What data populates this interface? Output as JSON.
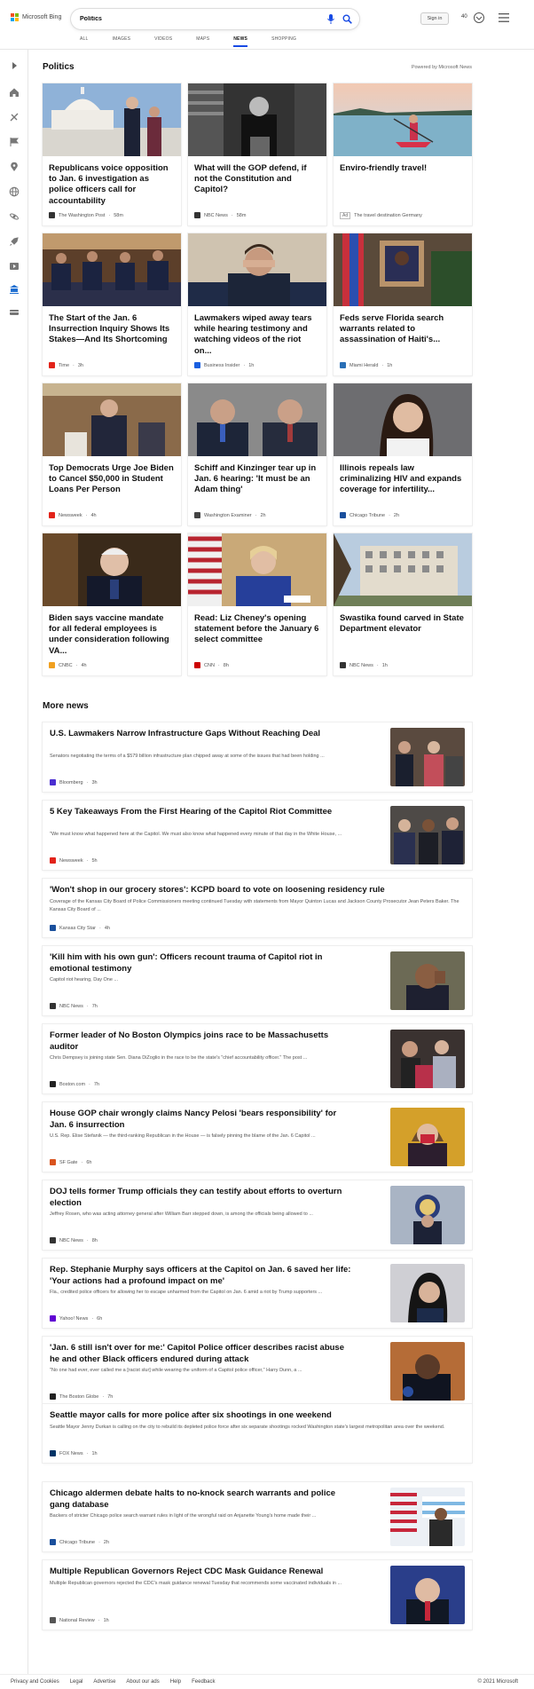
{
  "header": {
    "brand": "Microsoft Bing",
    "search_value": "Politics",
    "signin_label": "Sign in",
    "points": "40",
    "tabs": [
      {
        "label": "ALL"
      },
      {
        "label": "IMAGES"
      },
      {
        "label": "VIDEOS"
      },
      {
        "label": "MAPS"
      },
      {
        "label": "NEWS"
      },
      {
        "label": "SHOPPING"
      }
    ],
    "active_tab": "NEWS"
  },
  "sidebar": {
    "icons": [
      "expand-icon",
      "home-icon",
      "sports-icon",
      "flag-icon",
      "location-icon",
      "globe-icon",
      "science-icon",
      "rocket-icon",
      "entertainment-icon",
      "bank-icon",
      "money-icon"
    ]
  },
  "section": {
    "title": "Politics",
    "powered_by": "Powered by Microsoft News"
  },
  "cards": [
    {
      "title": "Republicans voice opposition to Jan. 6 investigation as police officers call for accountability",
      "source": "The Washington Post",
      "time": "58m",
      "logo_color": "#333",
      "image": "capitol"
    },
    {
      "title": "What will the GOP defend, if not the Constitution and Capitol?",
      "source": "NBC News",
      "time": "58m",
      "logo_color": "#333",
      "image": "podium-bw"
    },
    {
      "title": "Enviro-friendly travel!",
      "source": "The travel destination Germany",
      "time": "",
      "ad": "Ad",
      "logo_color": "",
      "image": "kayak"
    },
    {
      "title": "The Start of the Jan. 6 Insurrection Inquiry Shows Its Stakes—And Its Shortcoming",
      "source": "Time",
      "time": "3h",
      "logo_color": "#e2231a",
      "image": "hearing"
    },
    {
      "title": "Lawmakers wiped away tears while hearing testimony and watching videos of the riot on...",
      "source": "Business Insider",
      "time": "1h",
      "logo_color": "#1a5fe0",
      "image": "tears"
    },
    {
      "title": "Feds serve Florida search warrants related to assassination of Haiti's...",
      "source": "Miami Herald",
      "time": "1h",
      "logo_color": "#2a6fb5",
      "image": "portrait"
    },
    {
      "title": "Top Democrats Urge Joe Biden to Cancel $50,000 in Student Loans Per Person",
      "source": "Newsweek",
      "time": "4h",
      "logo_color": "#e2231a",
      "image": "senate"
    },
    {
      "title": "Schiff and Kinzinger tear up in Jan. 6 hearing: 'It must be an Adam thing'",
      "source": "Washington Examiner",
      "time": "2h",
      "logo_color": "#444",
      "image": "schiff"
    },
    {
      "title": "Illinois repeals law criminalizing HIV and expands coverage for infertility...",
      "source": "Chicago Tribune",
      "time": "2h",
      "logo_color": "#1a4f9c",
      "image": "woman"
    },
    {
      "title": "Biden says vaccine mandate for all federal employees is under consideration following VA...",
      "source": "CNBC",
      "time": "4h",
      "logo_color": "#f0a020",
      "image": "biden"
    },
    {
      "title": "Read: Liz Cheney's opening statement before the January 6 select committee",
      "source": "CNN",
      "time": "8h",
      "logo_color": "#cc0000",
      "image": "cheney"
    },
    {
      "title": "Swastika found carved in State Department elevator",
      "source": "NBC News",
      "time": "1h",
      "logo_color": "#333",
      "image": "building"
    }
  ],
  "more_news": {
    "title": "More news",
    "items": [
      {
        "title": "U.S. Lawmakers Narrow Infrastructure Gaps Without Reaching Deal",
        "snippet": "Senators negotiating the terms of a $579 billion infrastructure plan chipped away at some of the issues that had been holding ...",
        "source": "Bloomberg",
        "time": "3h",
        "logo_color": "#4a2ed1",
        "image": "infra"
      },
      {
        "title": "5 Key Takeaways From the First Hearing of the Capitol Riot Committee",
        "snippet": "\"We must know what happened here at the Capitol. We must also know what happened every minute of that day in the White House, ...",
        "source": "Newsweek",
        "time": "5h",
        "logo_color": "#e2231a",
        "image": "police"
      },
      {
        "title": "'Won't shop in our grocery stores': KCPD board to vote on loosening residency rule",
        "snippet": "Coverage of the Kansas City Board of Police Commissioners meeting continued Tuesday with statements from Mayor Quinton Lucas and Jackson County Prosecutor Jean Peters Baker. The Kansas City Board of ...",
        "source": "Kansas City Star",
        "time": "4h",
        "logo_color": "#1a4f9c",
        "image": ""
      },
      {
        "title": "'Kill him with his own gun': Officers recount trauma of Capitol riot in emotional testimony",
        "snippet": "Capitol riot hearing, Day One ...",
        "source": "NBC News",
        "time": "7h",
        "logo_color": "#333",
        "image": "officer"
      },
      {
        "title": "Former leader of No Boston Olympics joins race to be Massachusetts auditor",
        "snippet": "Chris Dempsey is joining state Sen. Diana DiZoglio in the race to be the state's \"chief accountability officer.\" The post ...",
        "source": "Boston.com",
        "time": "7h",
        "logo_color": "#222",
        "image": "boston"
      },
      {
        "title": "House GOP chair wrongly claims Nancy Pelosi 'bears responsibility' for Jan. 6 insurrection",
        "snippet": "U.S. Rep. Elise Stefanik — the third-ranking Republican in the House — is falsely pinning the blame of the Jan. 6 Capitol ...",
        "source": "SF Gate",
        "time": "6h",
        "logo_color": "#d9531e",
        "image": "pelosi"
      },
      {
        "title": "DOJ tells former Trump officials they can testify about efforts to overturn election",
        "snippet": "Jeffrey Rosen, who was acting attorney general after William Barr stepped down, is among the officials being allowed to ...",
        "source": "NBC News",
        "time": "8h",
        "logo_color": "#333",
        "image": "doj"
      },
      {
        "title": "Rep. Stephanie Murphy says officers at the Capitol on Jan. 6 saved her life: 'Your actions had a profound impact on me'",
        "snippet": "Fla., credited police officers for allowing her to escape unharmed from the Capitol on Jan. 6 amid a riot by Trump supporters ...",
        "source": "Yahoo! News",
        "time": "6h",
        "logo_color": "#6001d2",
        "image": "murphy"
      },
      {
        "title": "'Jan. 6 still isn't over for me:' Capitol Police officer describes racist abuse he and other Black officers endured during attack",
        "snippet": "\"No one had ever, ever called me a [racist slur] while wearing the uniform of a Capitol police officer,\" Harry Dunn, a ...",
        "source": "The Boston Globe",
        "time": "7h",
        "logo_color": "#222",
        "image": "dunn"
      },
      {
        "title": "Seattle mayor calls for more police after six shootings in one weekend",
        "snippet": "Seattle Mayor Jenny Durkan is calling on the city to rebuild its depleted police force after six separate shootings rocked Washington state's largest metropolitan area over the weekend.",
        "source": "FOX News",
        "time": "1h",
        "logo_color": "#003366",
        "image": ""
      },
      {
        "title": "Chicago aldermen debate halts to no-knock search warrants and police gang database",
        "snippet": "Backers of stricter Chicago police search warrant rules in light of the wrongful raid on Anjanette Young's home made their ...",
        "source": "Chicago Tribune",
        "time": "2h",
        "logo_color": "#1a4f9c",
        "image": "chicago"
      },
      {
        "title": "Multiple Republican Governors Reject CDC Mask Guidance Renewal",
        "snippet": "Multiple Republican governors rejected the CDC's mask guidance renewal Tuesday that recommends some vaccinated individuals in ...",
        "source": "National Review",
        "time": "1h",
        "logo_color": "#555",
        "image": "governor"
      }
    ]
  },
  "footer": {
    "links": [
      "Privacy and Cookies",
      "Legal",
      "Advertise",
      "About our ads",
      "Help",
      "Feedback"
    ],
    "copyright": "© 2021 Microsoft"
  }
}
